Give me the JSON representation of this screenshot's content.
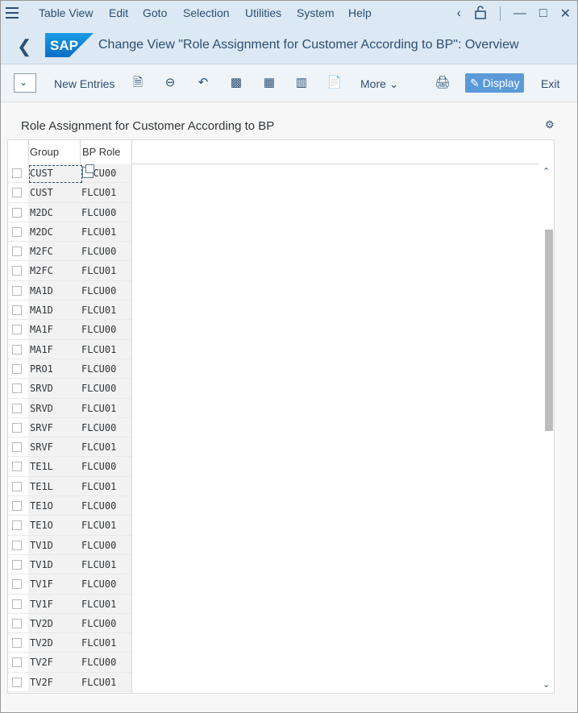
{
  "menubar": {
    "items": [
      "Table View",
      "Edit",
      "Goto",
      "Selection",
      "Utilities",
      "System",
      "Help"
    ]
  },
  "titlebar": {
    "logo": "SAP",
    "title": "Change View \"Role Assignment for Customer According to BP\": Overview"
  },
  "toolbar": {
    "new_entries": "New Entries",
    "more": "More",
    "display": "Display",
    "exit": "Exit"
  },
  "table": {
    "title": "Role Assignment for Customer According to BP",
    "columns": [
      "Group",
      "BP Role"
    ],
    "rows": [
      [
        "CUST",
        "FLCU00"
      ],
      [
        "CUST",
        "FLCU01"
      ],
      [
        "M2DC",
        "FLCU00"
      ],
      [
        "M2DC",
        "FLCU01"
      ],
      [
        "M2FC",
        "FLCU00"
      ],
      [
        "M2FC",
        "FLCU01"
      ],
      [
        "MA1D",
        "FLCU00"
      ],
      [
        "MA1D",
        "FLCU01"
      ],
      [
        "MA1F",
        "FLCU00"
      ],
      [
        "MA1F",
        "FLCU01"
      ],
      [
        "PRO1",
        "FLCU00"
      ],
      [
        "SRVD",
        "FLCU00"
      ],
      [
        "SRVD",
        "FLCU01"
      ],
      [
        "SRVF",
        "FLCU00"
      ],
      [
        "SRVF",
        "FLCU01"
      ],
      [
        "TE1L",
        "FLCU00"
      ],
      [
        "TE1L",
        "FLCU01"
      ],
      [
        "TE1O",
        "FLCU00"
      ],
      [
        "TE1O",
        "FLCU01"
      ],
      [
        "TV1D",
        "FLCU00"
      ],
      [
        "TV1D",
        "FLCU01"
      ],
      [
        "TV1F",
        "FLCU00"
      ],
      [
        "TV1F",
        "FLCU01"
      ],
      [
        "TV2D",
        "FLCU00"
      ],
      [
        "TV2D",
        "FLCU01"
      ],
      [
        "TV2F",
        "FLCU00"
      ],
      [
        "TV2F",
        "FLCU01"
      ]
    ]
  },
  "colors": {
    "accent": "#5b9ad8",
    "header_bg": "#dce8f3",
    "text_blue": "#2c4f73"
  }
}
